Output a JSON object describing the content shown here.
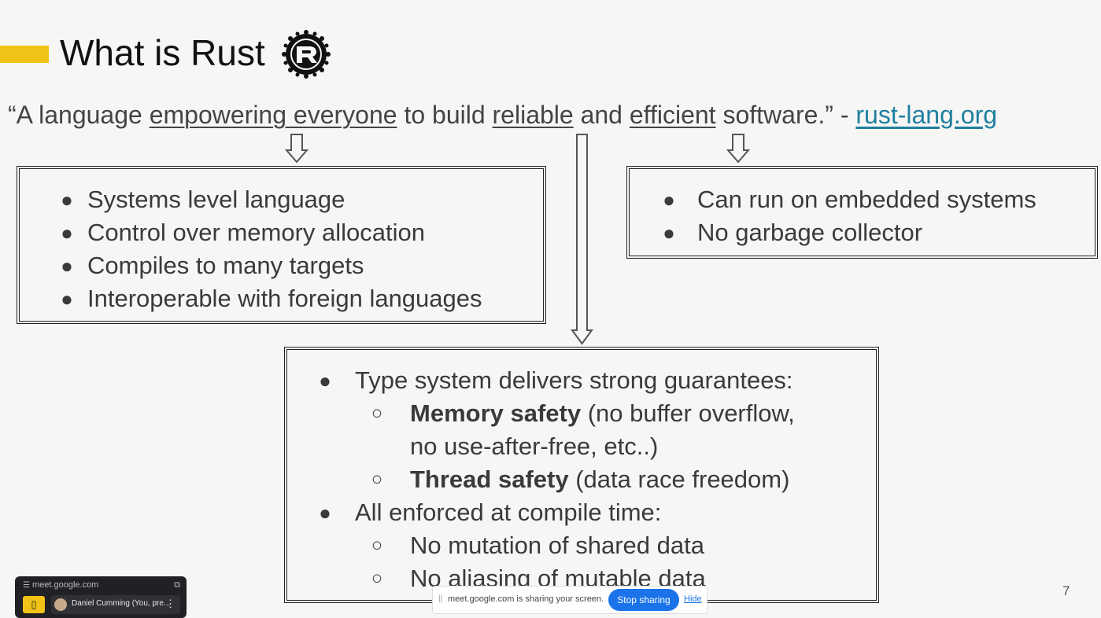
{
  "slide": {
    "title": "What is Rust",
    "tagline": {
      "part1": "“A language ",
      "u1": "empowering everyone",
      "part2": " to build ",
      "u2": "reliable",
      "part3": " and ",
      "u3": "efficient",
      "part4": " software.” - ",
      "link": "rust-lang.org"
    },
    "box_empowering": [
      "Systems level language",
      "Control over memory allocation",
      "Compiles to many targets",
      "Interoperable with foreign languages"
    ],
    "box_efficient": [
      "Can run on embedded systems",
      "No garbage collector"
    ],
    "box_reliable": {
      "item1": "Type system delivers strong guarantees:",
      "sub1_bold": "Memory safety",
      "sub1_rest": " (no buffer overflow,",
      "sub1_cont": "no use-after-free, etc..)",
      "sub2_bold": "Thread safety",
      "sub2_rest": " (data race freedom)",
      "item2": "All enforced at compile time:",
      "sub3": "No mutation of shared data",
      "sub4": "No aliasing of mutable data"
    },
    "bullet_glyph": "●",
    "sub_bullet_glyph": "○",
    "page_number": "7",
    "accent_color": "#f2c317",
    "link_color": "#1f7fa0"
  },
  "meet_widget": {
    "url": "meet.google.com",
    "user_label": "Daniel Cumming (You, pre...",
    "icons": [
      "settings-tune-icon",
      "expand-icon",
      "door-icon",
      "avatar",
      "more-vert-icon"
    ]
  },
  "share_bar": {
    "grip": "||",
    "message": "meet.google.com is sharing your screen.",
    "stop_label": "Stop sharing",
    "hide_label": "Hide",
    "button_color": "#1a73e8"
  }
}
